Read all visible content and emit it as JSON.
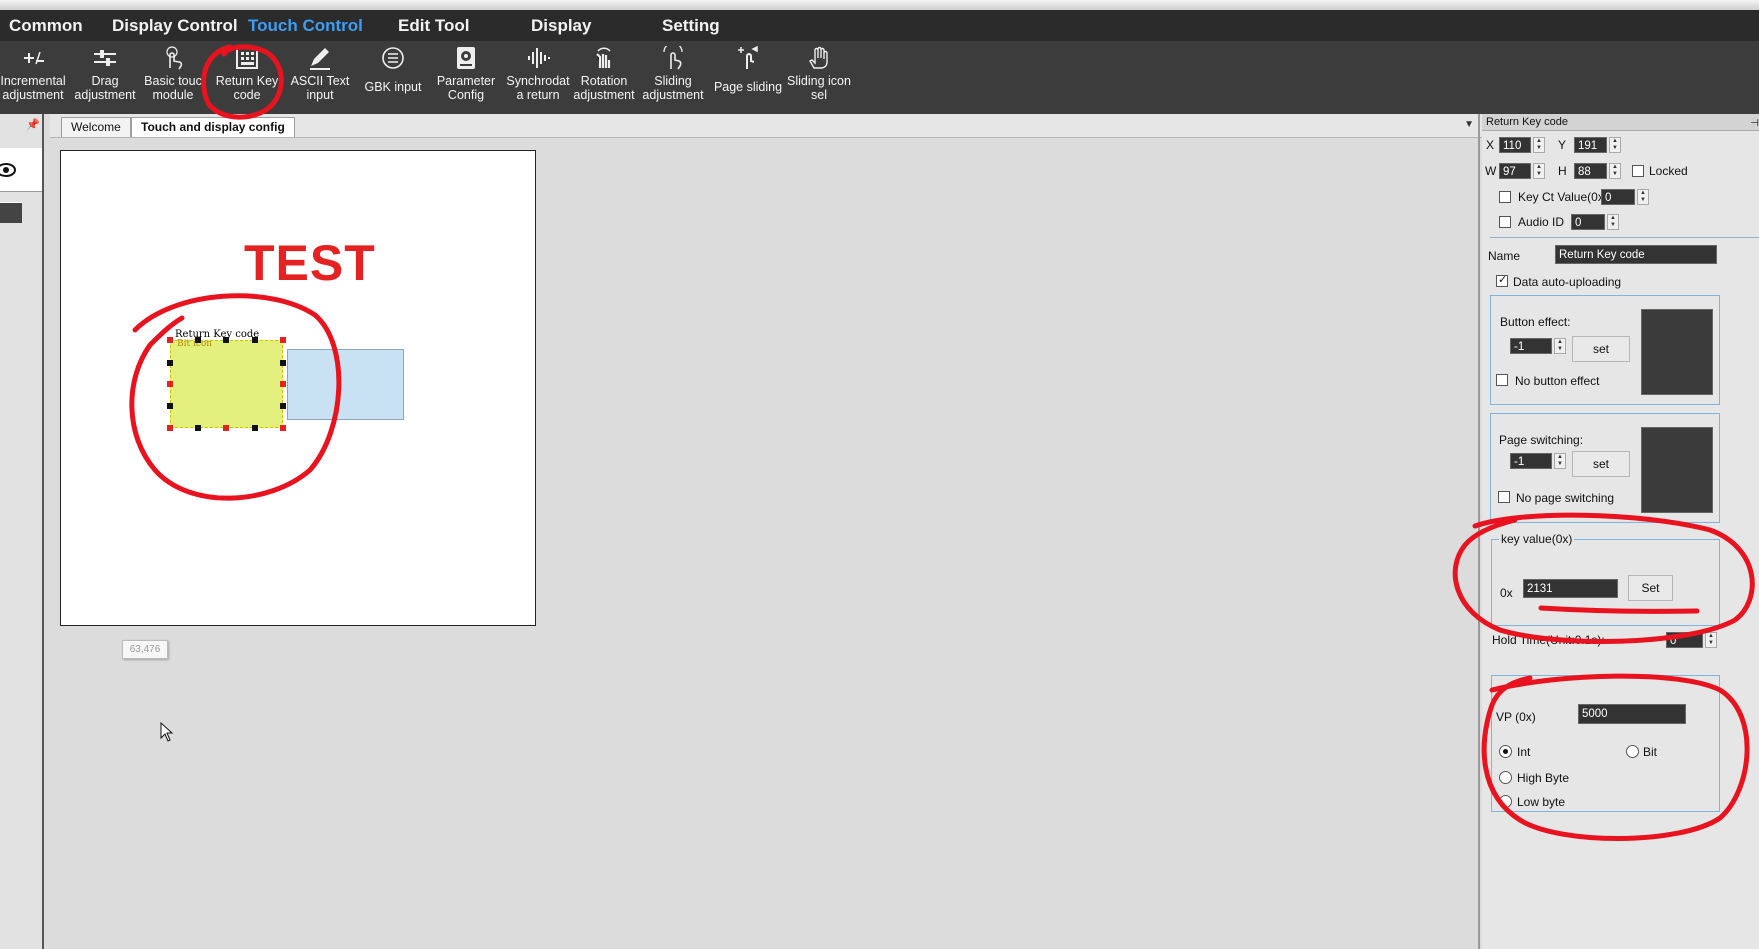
{
  "menu": {
    "items": [
      {
        "label": "Common"
      },
      {
        "label": "Display Control"
      },
      {
        "label": "Touch Control"
      },
      {
        "label": "Edit Tool"
      },
      {
        "label": "Display"
      },
      {
        "label": "Setting"
      }
    ],
    "active": "Touch Control"
  },
  "toolbar": {
    "tools": [
      {
        "label": "Incremental\nadjustment",
        "icon": "incremental-icon"
      },
      {
        "label": "Drag\nadjustment",
        "icon": "drag-icon"
      },
      {
        "label": "Basic touc\nmodule",
        "icon": "touch-hand-icon"
      },
      {
        "label": "Return Key\ncode",
        "icon": "keypad-icon"
      },
      {
        "label": "ASCII Text\ninput",
        "icon": "pen-icon"
      },
      {
        "label": "GBK input",
        "icon": "list-circle-icon"
      },
      {
        "label": "Parameter\nConfig",
        "icon": "config-icon"
      },
      {
        "label": "Synchrodat\na return",
        "icon": "sound-wave-icon"
      },
      {
        "label": "Rotation\nadjustment",
        "icon": "rotate-hand-icon"
      },
      {
        "label": "Sliding\nadjustment",
        "icon": "slide-hand-icon"
      },
      {
        "label": "Page sliding",
        "icon": "swipe-icon"
      },
      {
        "label": "Sliding icon\nsel",
        "icon": "hand-icon"
      }
    ]
  },
  "tabs": [
    {
      "label": "Welcome"
    },
    {
      "label": "Touch and display config"
    }
  ],
  "canvas": {
    "test_text": "TEST",
    "control_label": "Return Key code",
    "sub_label": "Bit icon",
    "coord_tooltip": "63,476"
  },
  "properties": {
    "title": "Return Key code",
    "x_label": "X",
    "x": "110",
    "y_label": "Y",
    "y": "191",
    "w_label": "W",
    "w": "97",
    "h_label": "H",
    "h": "88",
    "locked_label": "Locked",
    "key_ct_label": "Key Ct Value(0x)",
    "key_ct": "0",
    "audio_label": "Audio ID",
    "audio": "0",
    "name_label": "Name",
    "name": "Return Key code",
    "auto_upload_label": "Data auto-uploading",
    "button_effect_label": "Button effect:",
    "button_effect": "-1",
    "set_label": "set",
    "no_button_effect_label": "No button effect",
    "page_switching_label": "Page switching:",
    "page_switching": "-1",
    "no_page_switching_label": "No page switching",
    "key_value_group": "key value(0x)",
    "key_prefix": "0x",
    "key_value": "2131",
    "key_set_label": "Set",
    "hold_time_label": "Hold Time(Unit:0.1s):",
    "hold_time": "0",
    "vp_label": "VP (0x)",
    "vp": "5000",
    "int_label": "Int",
    "bit_label": "Bit",
    "high_byte_label": "High Byte",
    "low_byte_label": "Low byte"
  },
  "colors": {
    "menu_active": "#3d9df3",
    "annotation": "#e8131f",
    "test_text": "#e52222"
  }
}
